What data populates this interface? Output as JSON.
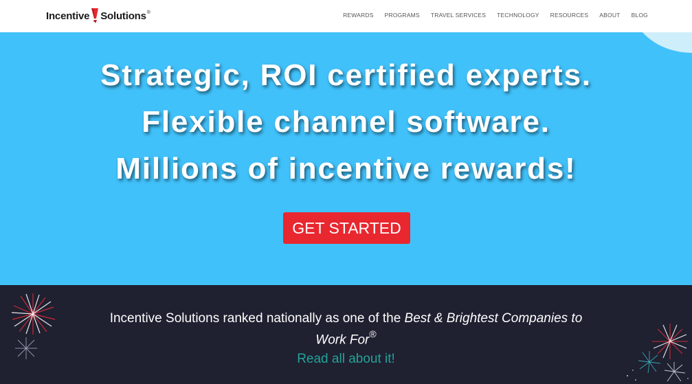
{
  "header": {
    "logo": {
      "word1": "Incentive",
      "word2": "Solutions",
      "registered_mark": "®"
    },
    "nav": [
      "REWARDS",
      "PROGRAMS",
      "TRAVEL SERVICES",
      "TECHNOLOGY",
      "RESOURCES",
      "ABOUT",
      "BLOG"
    ]
  },
  "hero": {
    "background_color": "#41c1fa",
    "headline_lines": [
      "Strategic, ROI certified experts.",
      "Flexible channel software.",
      "Millions of incentive rewards!"
    ],
    "cta_label": "GET STARTED",
    "cta_color": "#e8272f"
  },
  "banner": {
    "background_color": "#1f2030",
    "text_plain": "Incentive Solutions ranked nationally as one of the",
    "text_italic_1": "Best & Brightest Companies to",
    "text_italic_2": "Work For",
    "registered_mark": "®",
    "link_text": "Read all about it!",
    "link_color": "#23a39a"
  }
}
